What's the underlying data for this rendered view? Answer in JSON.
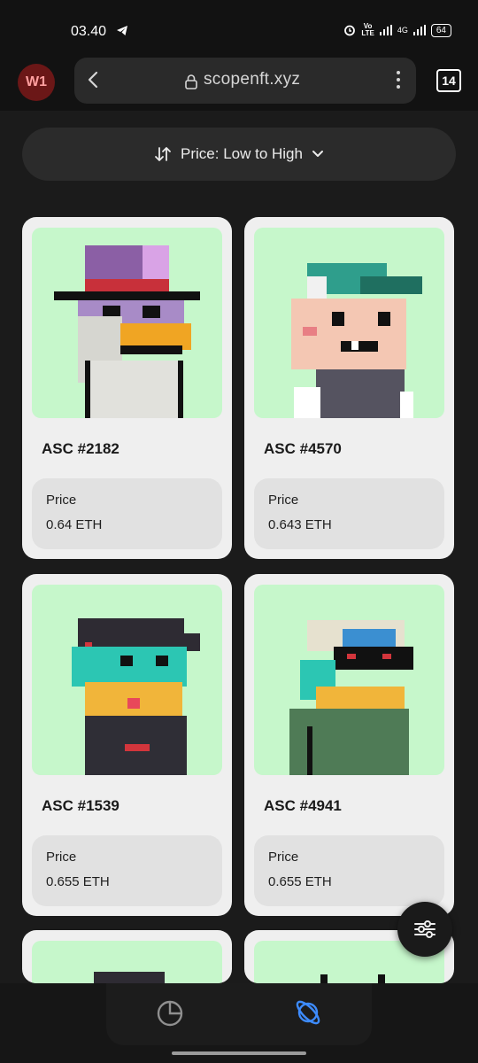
{
  "status": {
    "time": "03.40",
    "battery": "64",
    "network": "4G",
    "volte_top": "Vo",
    "volte_bottom": "LTE"
  },
  "browser": {
    "profile_label": "W1",
    "url": "scopenft.xyz",
    "tab_count": "14"
  },
  "sort": {
    "label": "Price: Low to High"
  },
  "cards": [
    {
      "name": "ASC #2182",
      "price_label": "Price",
      "price": "0.64 ETH"
    },
    {
      "name": "ASC #4570",
      "price_label": "Price",
      "price": "0.643 ETH"
    },
    {
      "name": "ASC #1539",
      "price_label": "Price",
      "price": "0.655 ETH"
    },
    {
      "name": "ASC #4941",
      "price_label": "Price",
      "price": "0.655 ETH"
    }
  ],
  "colors": {
    "art_bg": "#c6f7cb",
    "card_bg": "#efefef",
    "accent_blue": "#3d8bfd",
    "profile_bg": "#6b1717"
  },
  "nav": {
    "items": [
      "portfolio-icon",
      "explore-planet-icon"
    ],
    "active": "explore-planet-icon"
  }
}
